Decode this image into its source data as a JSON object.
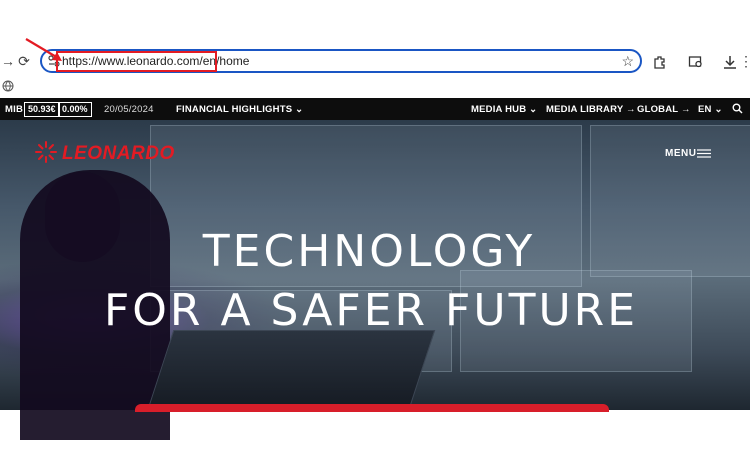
{
  "browser": {
    "url": "https://www.leonardo.com/en/home"
  },
  "topbar": {
    "ticker": "MIB",
    "price": "50.93€",
    "change": "0.00%",
    "date": "20/05/2024",
    "financial_highlights": "FINANCIAL HIGHLIGHTS",
    "media_hub": "MEDIA HUB",
    "media_library": "MEDIA LIBRARY",
    "global": "GLOBAL",
    "language": "EN"
  },
  "hero": {
    "logo": "LEONARDO",
    "menu": "MENU",
    "headline_line1": "TECHNOLOGY",
    "headline_line2": "FOR A SAFER FUTURE"
  },
  "colors": {
    "brand_red": "#e31b23",
    "omnibox_border": "#1a56c4",
    "topbar_bg": "#0d0d0d"
  }
}
